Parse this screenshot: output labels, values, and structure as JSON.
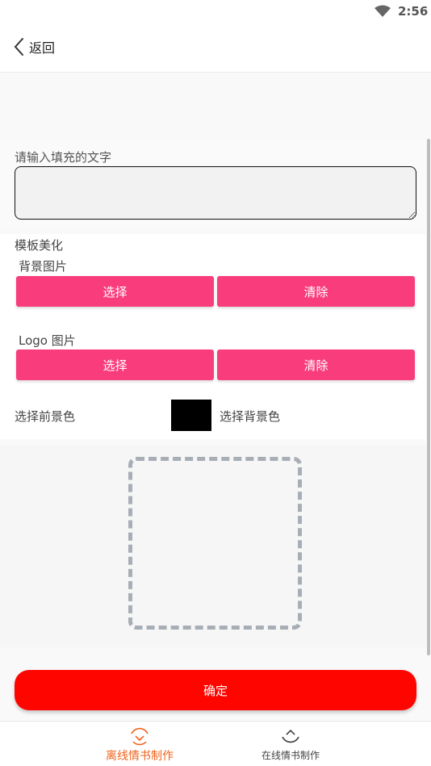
{
  "status_bar": {
    "time": "2:56",
    "icon": "wifi-icon"
  },
  "nav": {
    "back_label": "返回",
    "back_icon": "chevron-left-icon"
  },
  "form": {
    "input_label": "请输入填充的文字",
    "input_value": "",
    "template_section": "模板美化",
    "bg_image_label": "背景图片",
    "bg_select": "选择",
    "bg_clear": "清除",
    "logo_image_label": "Logo 图片",
    "logo_select": "选择",
    "logo_clear": "清除",
    "fg_color_label": "选择前景色",
    "fg_color": "#000000",
    "bg_color_label": "选择背景色"
  },
  "confirm_label": "确定",
  "tabs": [
    {
      "label": "离线情书制作",
      "active": true,
      "icon": "chevron-down-circle-icon"
    },
    {
      "label": "在线情书制作",
      "active": false,
      "icon": "chevron-up-circle-icon"
    }
  ],
  "colors": {
    "accent_pink": "#f93d7c",
    "confirm_red": "#ff0500",
    "active_tab": "#f0641e"
  }
}
